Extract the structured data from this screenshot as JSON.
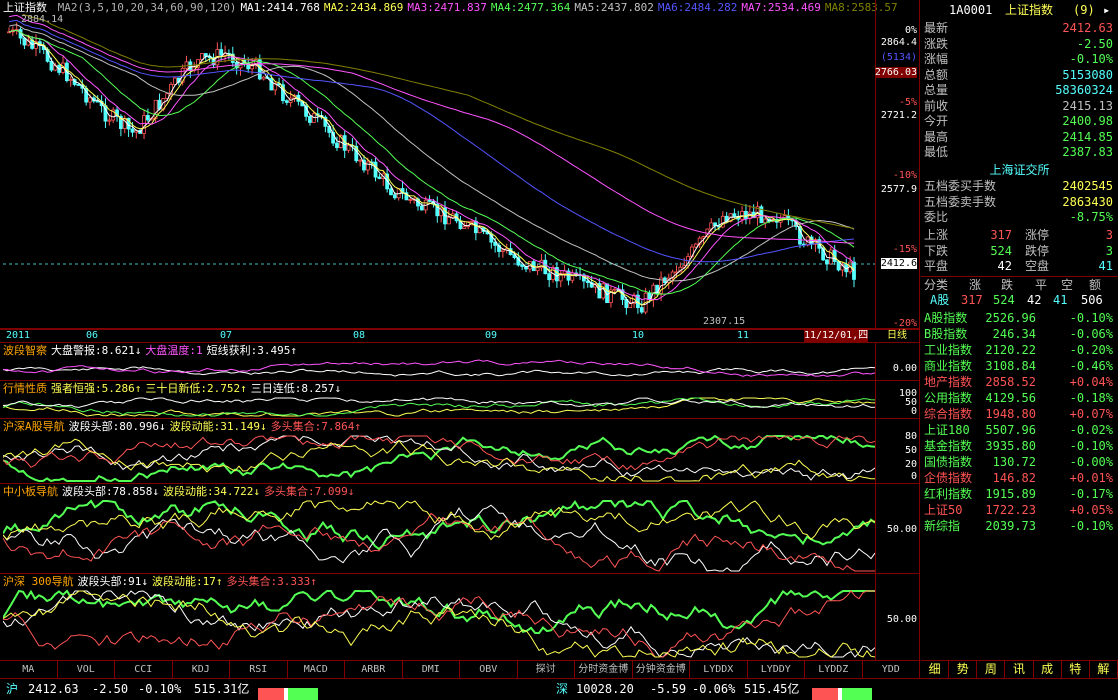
{
  "chart_title": "上证指数",
  "ma_labels": [
    {
      "text": "MA2(3,5,10,20,34,60,90,120)",
      "color": "#b0b0b0"
    },
    {
      "text": "MA1:2414.768",
      "color": "#ffffff"
    },
    {
      "text": "MA2:2434.869",
      "color": "#ffff54"
    },
    {
      "text": "MA3:2471.837",
      "color": "#ff54ff"
    },
    {
      "text": "MA4:2477.364",
      "color": "#54ff54"
    },
    {
      "text": "MA5:2437.802",
      "color": "#c0c0c0"
    },
    {
      "text": "MA6:2484.282",
      "color": "#5454ff"
    },
    {
      "text": "MA7:2534.469",
      "color": "#ff54ff"
    },
    {
      "text": "MA8:2583.57",
      "color": "#808000"
    }
  ],
  "high_label": "2884.14",
  "low_label": "2307.15",
  "price_scale": {
    "pct": [
      "0%",
      "-5%",
      "-10%",
      "-15%",
      "-20%"
    ],
    "price": [
      "2864.4",
      "(5134)",
      "2766.03",
      "2721.2",
      "2577.9",
      "2412.6"
    ]
  },
  "dates": [
    "2011",
    "06",
    "07",
    "08",
    "09",
    "10",
    "11",
    "11/12/01,四",
    "日线"
  ],
  "panels": [
    {
      "title": "波段智察",
      "items": [
        {
          "t": "大盘警报:8.621↓",
          "c": "#ffffff"
        },
        {
          "t": "大盘温度:1",
          "c": "#ff54ff"
        },
        {
          "t": "短线获利:3.495↑",
          "c": "#ffffff"
        }
      ],
      "scale": [
        "0.00"
      ]
    },
    {
      "title": "行情性质",
      "items": [
        {
          "t": "强者恒强:5.286↑",
          "c": "#ffff54"
        },
        {
          "t": "三十日新低:2.752↑",
          "c": "#ffff54"
        },
        {
          "t": "三日连低:8.257↓",
          "c": "#ffffff"
        }
      ],
      "scale": [
        "100",
        "50",
        "0"
      ]
    },
    {
      "title": "沪深A股导航",
      "items": [
        {
          "t": "波段头部:80.996↓",
          "c": "#ffffff"
        },
        {
          "t": "波段动能:31.149↓",
          "c": "#ffff54"
        },
        {
          "t": "多头集合:7.864↑",
          "c": "#ff5454"
        }
      ],
      "scale": [
        "80",
        "50",
        "20",
        "0"
      ]
    },
    {
      "title": "中小板导航",
      "items": [
        {
          "t": "波段头部:78.858↓",
          "c": "#ffffff"
        },
        {
          "t": "波段动能:34.722↓",
          "c": "#ffff54"
        },
        {
          "t": "多头集合:7.099↓",
          "c": "#ff5454"
        }
      ],
      "scale": [
        "50.00"
      ]
    },
    {
      "title": "沪深 300导航",
      "items": [
        {
          "t": "波段头部:91↓",
          "c": "#ffffff"
        },
        {
          "t": "波段动能:17↑",
          "c": "#ffff54"
        },
        {
          "t": "多头集合:3.333↑",
          "c": "#ff5454"
        }
      ],
      "scale": [
        "50.00"
      ]
    }
  ],
  "tabs": [
    "MA",
    "VOL",
    "CCI",
    "KDJ",
    "RSI",
    "MACD",
    "ARBR",
    "DMI",
    "OBV",
    "探讨",
    "分时资金博",
    "分钟资金博",
    "LYDDX",
    "LYDDY",
    "LYDDZ",
    "YDD"
  ],
  "sidebar": {
    "code": "1A0001",
    "name": "上证指数",
    "badge": "(9)",
    "quote": [
      {
        "k": "最新",
        "v": "2412.63",
        "c": "#ff5454"
      },
      {
        "k": "涨跌",
        "v": "-2.50",
        "c": "#54ff54"
      },
      {
        "k": "涨幅",
        "v": "-0.10%",
        "c": "#54ff54"
      },
      {
        "k": "总额",
        "v": "5153080",
        "c": "#54ffff"
      },
      {
        "k": "总量",
        "v": "58360324",
        "c": "#54ffff"
      },
      {
        "k": "前收",
        "v": "2415.13",
        "c": "#c0c0c0"
      },
      {
        "k": "今开",
        "v": "2400.98",
        "c": "#54ff54"
      },
      {
        "k": "最高",
        "v": "2414.85",
        "c": "#54ff54"
      },
      {
        "k": "最低",
        "v": "2387.83",
        "c": "#54ff54"
      }
    ],
    "exchange": "上海证交所",
    "depth": [
      {
        "k": "五档委买手数",
        "v": "2402545",
        "c": "#ffff54"
      },
      {
        "k": "五档委卖手数",
        "v": "2863430",
        "c": "#ffff54"
      },
      {
        "k": "委比",
        "v": "-8.75%",
        "c": "#54ff54"
      }
    ],
    "breadth": [
      {
        "k1": "上涨",
        "v1": "317",
        "c1": "#ff5454",
        "k2": "涨停",
        "v2": "3",
        "c2": "#ff5454"
      },
      {
        "k1": "下跌",
        "v1": "524",
        "c1": "#54ff54",
        "k2": "跌停",
        "v2": "3",
        "c2": "#54ff54"
      },
      {
        "k1": "平盘",
        "v1": "42",
        "c1": "#ffffff",
        "k2": "空盘",
        "v2": "41",
        "c2": "#54ffff"
      }
    ],
    "breadth_header": [
      "分类",
      "涨",
      "跌",
      "平",
      "空",
      "额"
    ],
    "breadth_row": [
      "A股",
      "317",
      "524",
      "42",
      "41",
      "506"
    ],
    "indices": [
      {
        "n": "A股指数",
        "p": "2526.96",
        "c": "-0.10%",
        "col": "#54ff54"
      },
      {
        "n": "B股指数",
        "p": "246.34",
        "c": "-0.06%",
        "col": "#54ff54"
      },
      {
        "n": "工业指数",
        "p": "2120.22",
        "c": "-0.20%",
        "col": "#54ff54"
      },
      {
        "n": "商业指数",
        "p": "3108.84",
        "c": "-0.46%",
        "col": "#54ff54"
      },
      {
        "n": "地产指数",
        "p": "2858.52",
        "c": "+0.04%",
        "col": "#ff5454"
      },
      {
        "n": "公用指数",
        "p": "4129.56",
        "c": "-0.18%",
        "col": "#54ff54"
      },
      {
        "n": "综合指数",
        "p": "1948.80",
        "c": "+0.07%",
        "col": "#ff5454"
      },
      {
        "n": "上证180",
        "p": "5507.96",
        "c": "-0.02%",
        "col": "#54ff54"
      },
      {
        "n": "基金指数",
        "p": "3935.80",
        "c": "-0.10%",
        "col": "#54ff54"
      },
      {
        "n": "国债指数",
        "p": "130.72",
        "c": "-0.00%",
        "col": "#54ff54"
      },
      {
        "n": "企债指数",
        "p": "146.82",
        "c": "+0.01%",
        "col": "#ff5454"
      },
      {
        "n": "红利指数",
        "p": "1915.89",
        "c": "-0.17%",
        "col": "#54ff54"
      },
      {
        "n": "上证50",
        "p": "1722.23",
        "c": "+0.05%",
        "col": "#ff5454"
      },
      {
        "n": "新综指",
        "p": "2039.73",
        "c": "-0.10%",
        "col": "#54ff54"
      }
    ],
    "bottom_tabs": [
      "细",
      "势",
      "周",
      "讯",
      "成",
      "特",
      "解"
    ]
  },
  "status": {
    "sh_label": "沪",
    "sh_price": "2412.63",
    "sh_chg": "-2.50",
    "sh_pct": "-0.10%",
    "sh_amt": "515.31亿",
    "sz_label": "深",
    "sz_price": "10028.20",
    "sz_chg": "-5.59",
    "sz_pct": "-0.06%",
    "sz_amt": "515.45亿"
  }
}
